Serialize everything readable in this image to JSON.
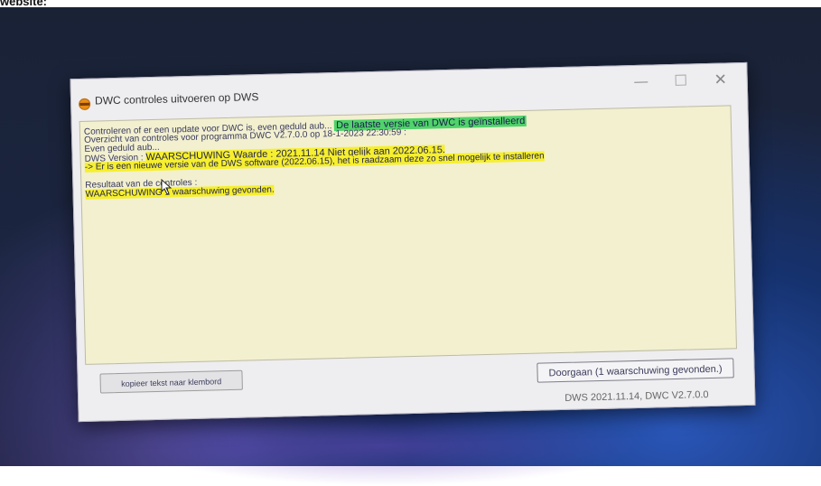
{
  "caption": "website:",
  "window": {
    "title": "DWC controles uitvoeren op DWS",
    "controls": {
      "minimize": "—",
      "close": "✕"
    }
  },
  "output": {
    "line1_prefix": "Controleren of er een update voor DWC is, even geduld aub...",
    "line1_result": "De laatste versie van DWC is geïnstalleerd",
    "line2": "Overzicht van controles voor programma DWC V2.7.0.0 op 18-1-2023 22:30:59 :",
    "line3": "Even geduld aub...",
    "line4_prefix": "DWS Version :",
    "line4_warning": "WAARSCHUWING Waarde : 2021.11.14 Niet gelijk aan 2022.06.15.",
    "line5": "-> Er is een nieuwe versie van de DWS software (2022.06.15), het is raadzaam deze zo snel mogelijk te installeren",
    "line6": "Resultaat van de controles :",
    "line7": "WAARSCHUWING 1 waarschuwing gevonden."
  },
  "buttons": {
    "copy": "kopieer tekst naar klembord",
    "continue": "Doorgaan (1 waarschuwing gevonden.)"
  },
  "status": "DWS 2021.11.14, DWC V2.7.0.0",
  "colors": {
    "output_bg": "#f2f0cf",
    "highlight_green": "#4fd36a",
    "highlight_yellow": "#f6ef2e",
    "app_icon": "#e98e16"
  },
  "icons": {
    "app": "dws-app-icon",
    "cursor": "mouse-pointer-icon"
  }
}
